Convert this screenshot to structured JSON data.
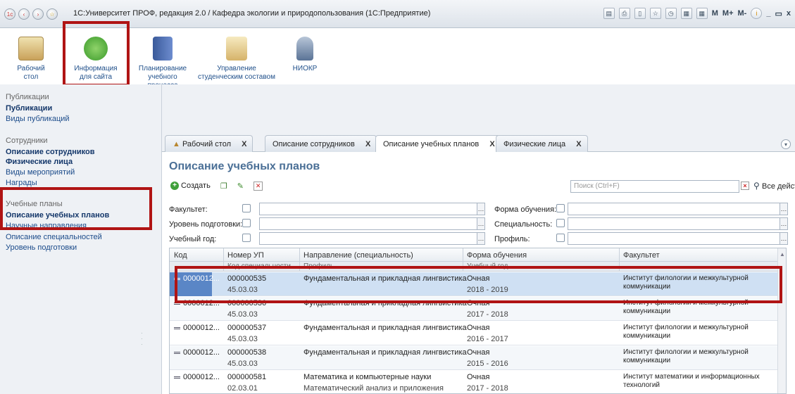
{
  "window": {
    "title": "1С:Университет ПРОФ, редакция 2.0 / Кафедра экологии и природопользования (1С:Предприятие)",
    "tools": {
      "m": "M",
      "mplus": "M+",
      "mminus": "M-",
      "info": "i",
      "min": "_",
      "restore": "▭",
      "close": "x"
    }
  },
  "sections": [
    {
      "label": "Рабочий\nстол",
      "l1": "Рабочий",
      "l2": "стол"
    },
    {
      "label": "Информация для сайта",
      "l1": "Информация",
      "l2": "для сайта"
    },
    {
      "label": "Планирование учебного процесса",
      "l1": "Планирование",
      "l2": "учебного процесса"
    },
    {
      "label": "Управление студенческим составом",
      "l1": "Управление",
      "l2": "студенческим составом"
    },
    {
      "label": "НИОКР",
      "l1": "НИОКР",
      "l2": ""
    }
  ],
  "nav": {
    "group1": "Публикации",
    "g1_items": [
      "Публикации",
      "Виды публикаций"
    ],
    "group2": "Сотрудники",
    "g2_items": [
      "Описание сотрудников",
      "Физические лица",
      "Виды мероприятий",
      "Награды"
    ],
    "group3": "Учебные планы",
    "g3_items": [
      "Описание учебных планов",
      "Научные направления",
      "Описание специальностей",
      "Уровень подготовки"
    ]
  },
  "tabs": [
    {
      "label": "Рабочий стол",
      "close": "X"
    },
    {
      "label": "Описание сотрудников",
      "close": "X"
    },
    {
      "label": "Описание учебных планов",
      "close": "X"
    },
    {
      "label": "Физические лица",
      "close": "X"
    }
  ],
  "form": {
    "title": "Описание учебных планов",
    "create": "Создать",
    "search_placeholder": "Поиск (Ctrl+F)",
    "all_actions": "Все действия ▾",
    "filters": {
      "faculty": "Факультет:",
      "level": "Уровень подготовки:",
      "year": "Учебный год:",
      "form": "Форма обучения:",
      "specialty": "Специальность:",
      "profile": "Профиль:"
    }
  },
  "table": {
    "headers": [
      "Код",
      "Номер УП",
      "Направление (специальность)",
      "Форма обучения",
      "Факультет"
    ],
    "subheaders": [
      "",
      "Код специальности",
      "Профиль",
      "Учебный год",
      ""
    ],
    "rows": [
      {
        "code": "0000012...",
        "num": "000000535",
        "spec_code": "45.03.03",
        "direction": "Фундаментальная и прикладная лингвистика",
        "profile": "",
        "form": "Очная",
        "year": "2018 - 2019",
        "faculty1": "Институт филологии и межкультурной",
        "faculty2": "коммуникации"
      },
      {
        "code": "0000012...",
        "num": "000000536",
        "spec_code": "45.03.03",
        "direction": "Фундаментальная и прикладная лингвистика",
        "profile": "",
        "form": "Очная",
        "year": "2017 - 2018",
        "faculty1": "Институт филологии и межкультурной",
        "faculty2": "коммуникации"
      },
      {
        "code": "0000012...",
        "num": "000000537",
        "spec_code": "45.03.03",
        "direction": "Фундаментальная и прикладная лингвистика",
        "profile": "",
        "form": "Очная",
        "year": "2016 - 2017",
        "faculty1": "Институт филологии и межкультурной",
        "faculty2": "коммуникации"
      },
      {
        "code": "0000012...",
        "num": "000000538",
        "spec_code": "45.03.03",
        "direction": "Фундаментальная и прикладная лингвистика",
        "profile": "",
        "form": "Очная",
        "year": "2015 - 2016",
        "faculty1": "Институт филологии и межкультурной",
        "faculty2": "коммуникации"
      },
      {
        "code": "0000012...",
        "num": "000000581",
        "spec_code": "02.03.01",
        "direction": "Математика и компьютерные науки",
        "profile": "Математический анализ и приложения",
        "form": "Очная",
        "year": "2017 - 2018",
        "faculty1": "Институт математики и информационных",
        "faculty2": "технологий"
      }
    ]
  },
  "colors": {
    "highlight_frame": "#b01414",
    "selected_row": "#cfe0f3",
    "title": "#4a6f96"
  }
}
